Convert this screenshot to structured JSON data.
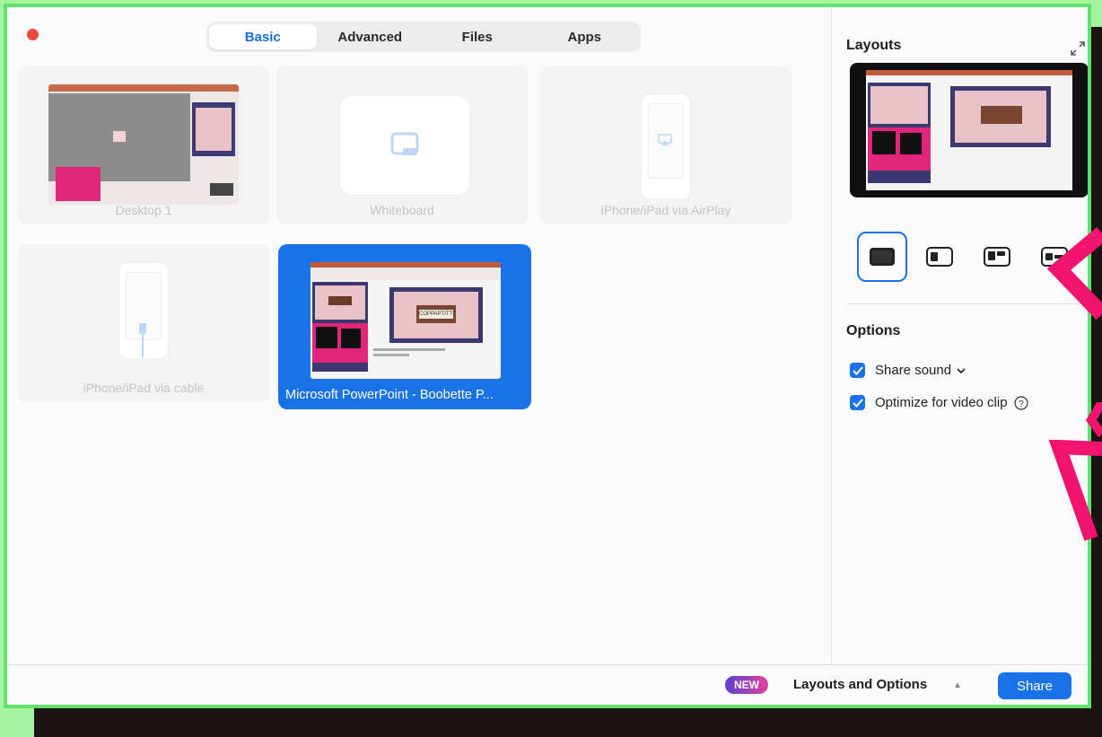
{
  "tabs": [
    {
      "label": "Basic",
      "active": true
    },
    {
      "label": "Advanced",
      "active": false
    },
    {
      "label": "Files",
      "active": false
    },
    {
      "label": "Apps",
      "active": false
    }
  ],
  "sources": [
    {
      "label": "Desktop 1"
    },
    {
      "label": "Whiteboard"
    },
    {
      "label": "iPhone/iPad via AirPlay"
    },
    {
      "label": "iPhone/iPad via cable"
    },
    {
      "label": "Microsoft PowerPoint - Boobette P...",
      "selected": true
    }
  ],
  "right_panel": {
    "layouts_title": "Layouts",
    "options_title": "Options",
    "share_sound_label": "Share sound",
    "share_sound_checked": true,
    "optimize_label": "Optimize for video clip",
    "optimize_checked": true,
    "slide_sign_text": "COPPAPTITTI"
  },
  "bottom_bar": {
    "new_badge": "NEW",
    "layouts_options_label": "Layouts and Options",
    "share_label": "Share"
  },
  "colors": {
    "accent": "#1a72e8",
    "frame_green": "#5fe36a",
    "annotation_pink": "#f0146e"
  }
}
